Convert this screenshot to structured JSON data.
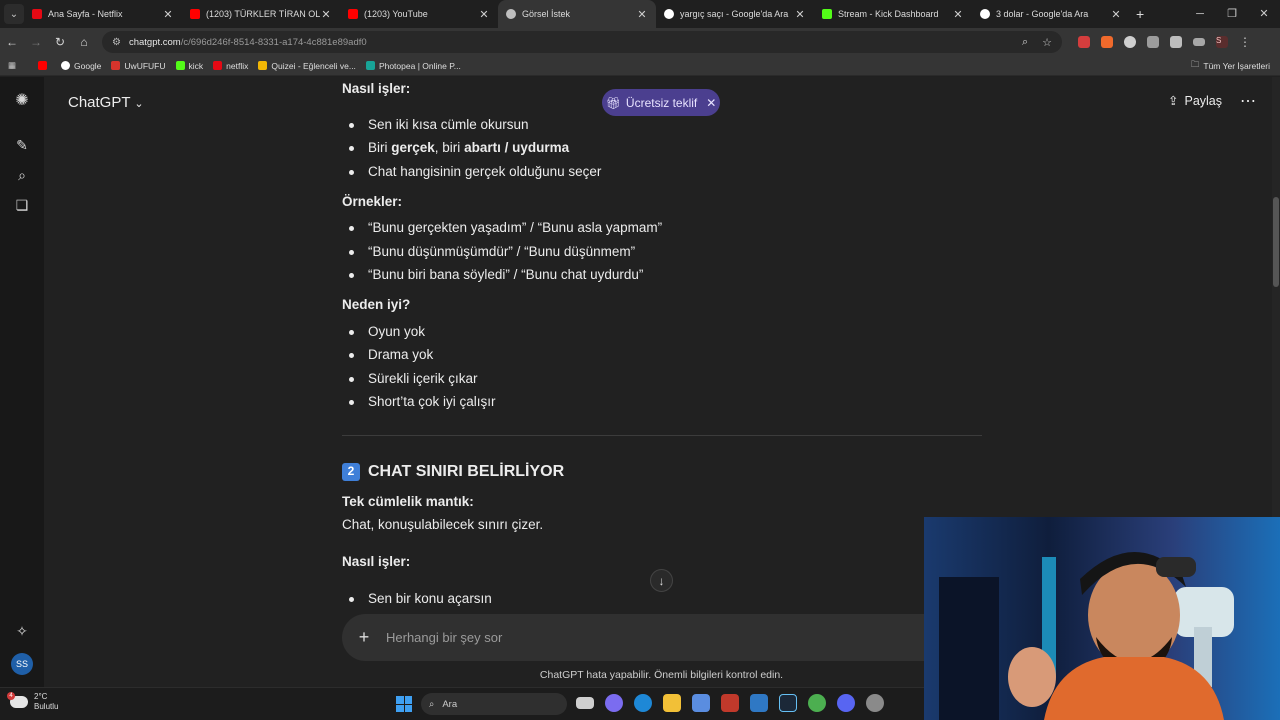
{
  "browser": {
    "tabs": [
      {
        "title": "Ana Sayfa - Netflix",
        "favicon_color": "#e50914",
        "active": false
      },
      {
        "title": "(1203) TÜRKLER TİRAN OLUYOR",
        "favicon_color": "#ff0000",
        "active": false
      },
      {
        "title": "(1203) YouTube",
        "favicon_color": "#ff0000",
        "active": false
      },
      {
        "title": "Görsel İstek",
        "favicon_color": "#bfbfbf",
        "active": true
      },
      {
        "title": "yargıç saçı - Google'da Ara",
        "favicon_color": "#ffffff",
        "active": false
      },
      {
        "title": "Stream - Kick Dashboard",
        "favicon_color": "#53fc18",
        "active": false
      },
      {
        "title": "3 dolar - Google'da Ara",
        "favicon_color": "#ffffff",
        "active": false
      }
    ],
    "url_host": "chatgpt.com",
    "url_path": "/c/696d246f-8514-8331-a174-4c881e89adf0",
    "bookmarks": [
      {
        "label": "",
        "favicon_color": "#ff0000"
      },
      {
        "label": "Google",
        "favicon_color": "#ffffff"
      },
      {
        "label": "UwUFUFU",
        "favicon_color": "#d6342c"
      },
      {
        "label": "kick",
        "favicon_color": "#53fc18"
      },
      {
        "label": "netflix",
        "favicon_color": "#e50914"
      },
      {
        "label": "Quizei - Eğlenceli ve...",
        "favicon_color": "#f2b705"
      },
      {
        "label": "Photopea | Online P...",
        "favicon_color": "#18a497"
      }
    ],
    "bookmarks_all": "Tüm Yer İşaretleri",
    "profile_initial": "S"
  },
  "app": {
    "model_label": "ChatGPT",
    "promo_label": "Ücretsiz teklif",
    "share_label": "Paylaş",
    "user_initials": "SS",
    "composer_placeholder": "Herhangi bir şey sor",
    "disclaimer": "ChatGPT hata yapabilir. Önemli bilgileri kontrol edin."
  },
  "message": {
    "s1_heading": "Nasıl işler:",
    "s1_items": [
      "Sen iki kısa cümle okursun",
      "Chat hangisinin gerçek olduğunu seçer"
    ],
    "s1_item2": {
      "pre": "Biri ",
      "b1": "gerçek",
      "mid": ", biri ",
      "b2": "abartı / uydurma"
    },
    "s2_heading": "Örnekler:",
    "s2_items": [
      "“Bunu gerçekten yaşadım” / “Bunu asla yapmam”",
      "“Bunu düşünmüşümdür” / “Bunu düşünmem”",
      "“Bunu biri bana söyledi” / “Bunu chat uydurdu”"
    ],
    "s3_heading": "Neden iyi?",
    "s3_items": [
      "Oyun yok",
      "Drama yok",
      "Sürekli içerik çıkar",
      "Short’ta çok iyi çalışır"
    ],
    "section_number": "2",
    "section_title": "CHAT SINIRI BELİRLİYOR",
    "s4_heading": "Tek cümlelik mantık:",
    "s4_text": "Chat, konuşulabilecek sınırı çizer.",
    "s5_heading": "Nasıl işler:",
    "s5_items": [
      "Sen bir konu açarsın"
    ]
  },
  "taskbar": {
    "temperature": "2°C",
    "condition": "Bulutlu",
    "weather_badge": "4",
    "search_label": "Ara"
  }
}
